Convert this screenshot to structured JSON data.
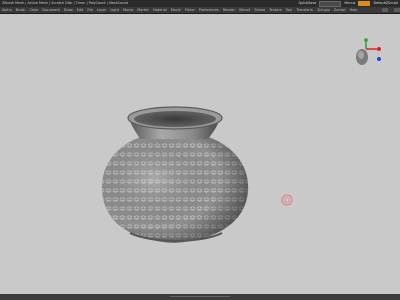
{
  "titlebar": {
    "title": "ZBrush Mesh  |  Active Mesh  |  Scratch Disk  |  Timer  |  PolyCount  |  MeshCount",
    "quicksave": "QuickSave",
    "menus_label": "Menus",
    "default_label": "DefaultZScript"
  },
  "menubar": {
    "items": [
      "Alpha",
      "Brush",
      "Color",
      "Document",
      "Draw",
      "Edit",
      "File",
      "Layer",
      "Light",
      "Macro",
      "Marker",
      "Material",
      "Movie",
      "Picker",
      "Preferences",
      "Render",
      "Stencil",
      "Stroke",
      "Texture",
      "Tool",
      "Transform",
      "Zplugin",
      "Zscript",
      "Help"
    ]
  },
  "canvas": {
    "background": "#c9c9c9",
    "object": "ceramic-vase",
    "cursor": "brush-cursor"
  },
  "colors": {
    "titlebar_bg": "#2b2b2b",
    "menubar_bg": "#3a3a3a",
    "canvas_bg": "#c9c9c9",
    "accent_orange": "#e08a1e",
    "gizmo_red": "#e02020",
    "gizmo_green": "#2aa02a",
    "gizmo_blue": "#2040e0"
  }
}
